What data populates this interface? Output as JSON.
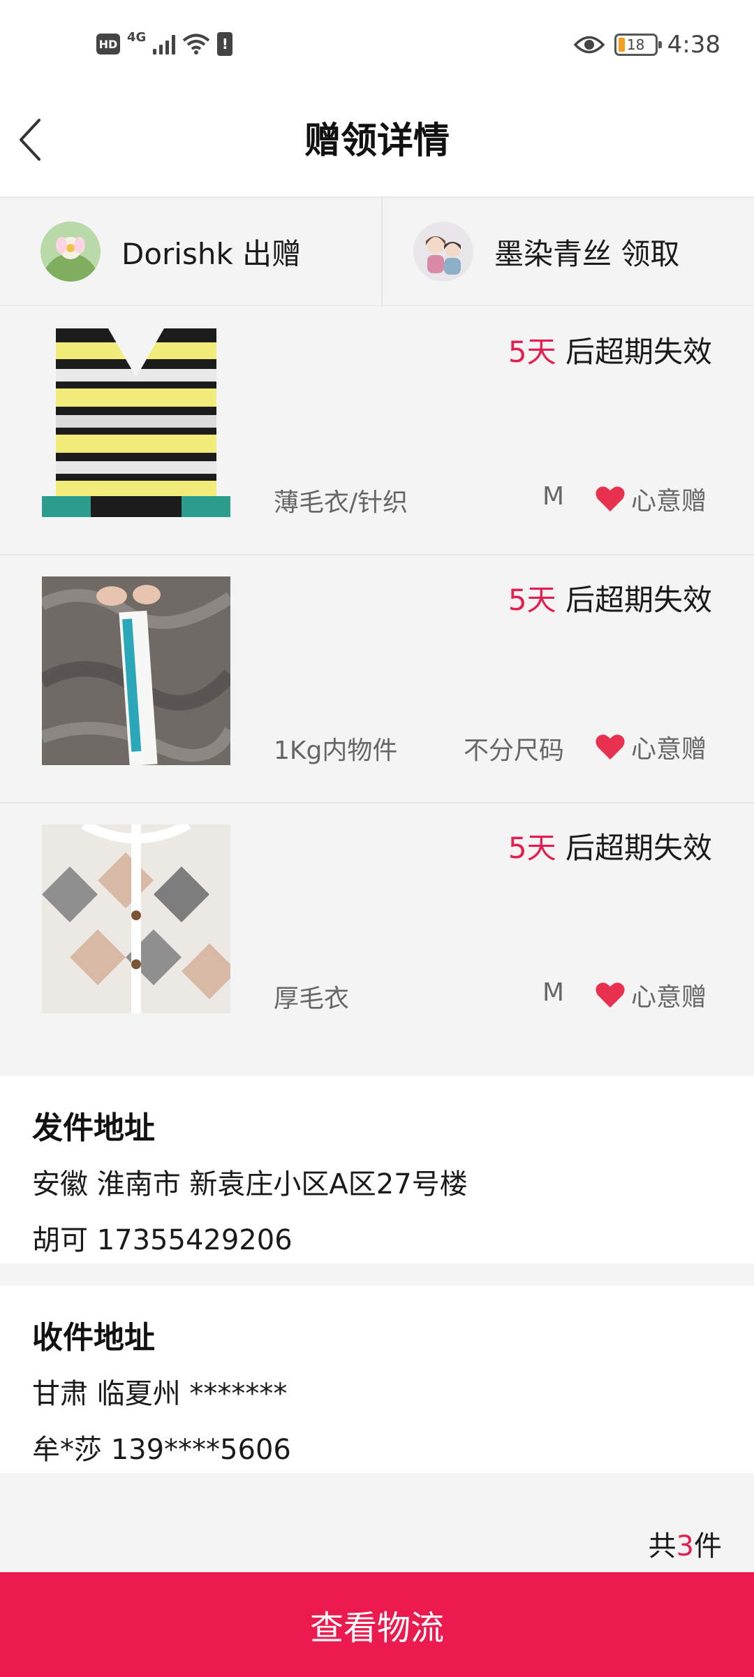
{
  "status_bar": {
    "hd": "HD",
    "network": "4G",
    "battery": "18",
    "time": "4:38"
  },
  "header": {
    "title": "赠领详情",
    "back_icon": "back-chevron-icon"
  },
  "parties": {
    "giver": "Dorishk 出赠",
    "receiver": "墨染青丝 领取"
  },
  "items": [
    {
      "days": "5天",
      "expiry_suffix": " 后超期失效",
      "category": "薄毛衣/针织",
      "size": "M",
      "tag": "心意赠"
    },
    {
      "days": "5天",
      "expiry_suffix": " 后超期失效",
      "category": "1Kg内物件",
      "size": "不分尺码",
      "tag": "心意赠"
    },
    {
      "days": "5天",
      "expiry_suffix": " 后超期失效",
      "category": "厚毛衣",
      "size": "M",
      "tag": "心意赠"
    }
  ],
  "sender_address": {
    "title": "发件地址",
    "line1": "安徽 淮南市 新袁庄小区A区27号楼",
    "line2": "胡可 17355429206"
  },
  "recipient_address": {
    "title": "收件地址",
    "line1": "甘肃 临夏州 *******",
    "line2": "牟*莎 139****5606"
  },
  "total": {
    "prefix": "共",
    "count": "3",
    "suffix": "件"
  },
  "cta_label": "查看物流",
  "colors": {
    "accent": "#EC1B4F",
    "days_text": "#E51E4F",
    "heart": "#E8304F"
  }
}
